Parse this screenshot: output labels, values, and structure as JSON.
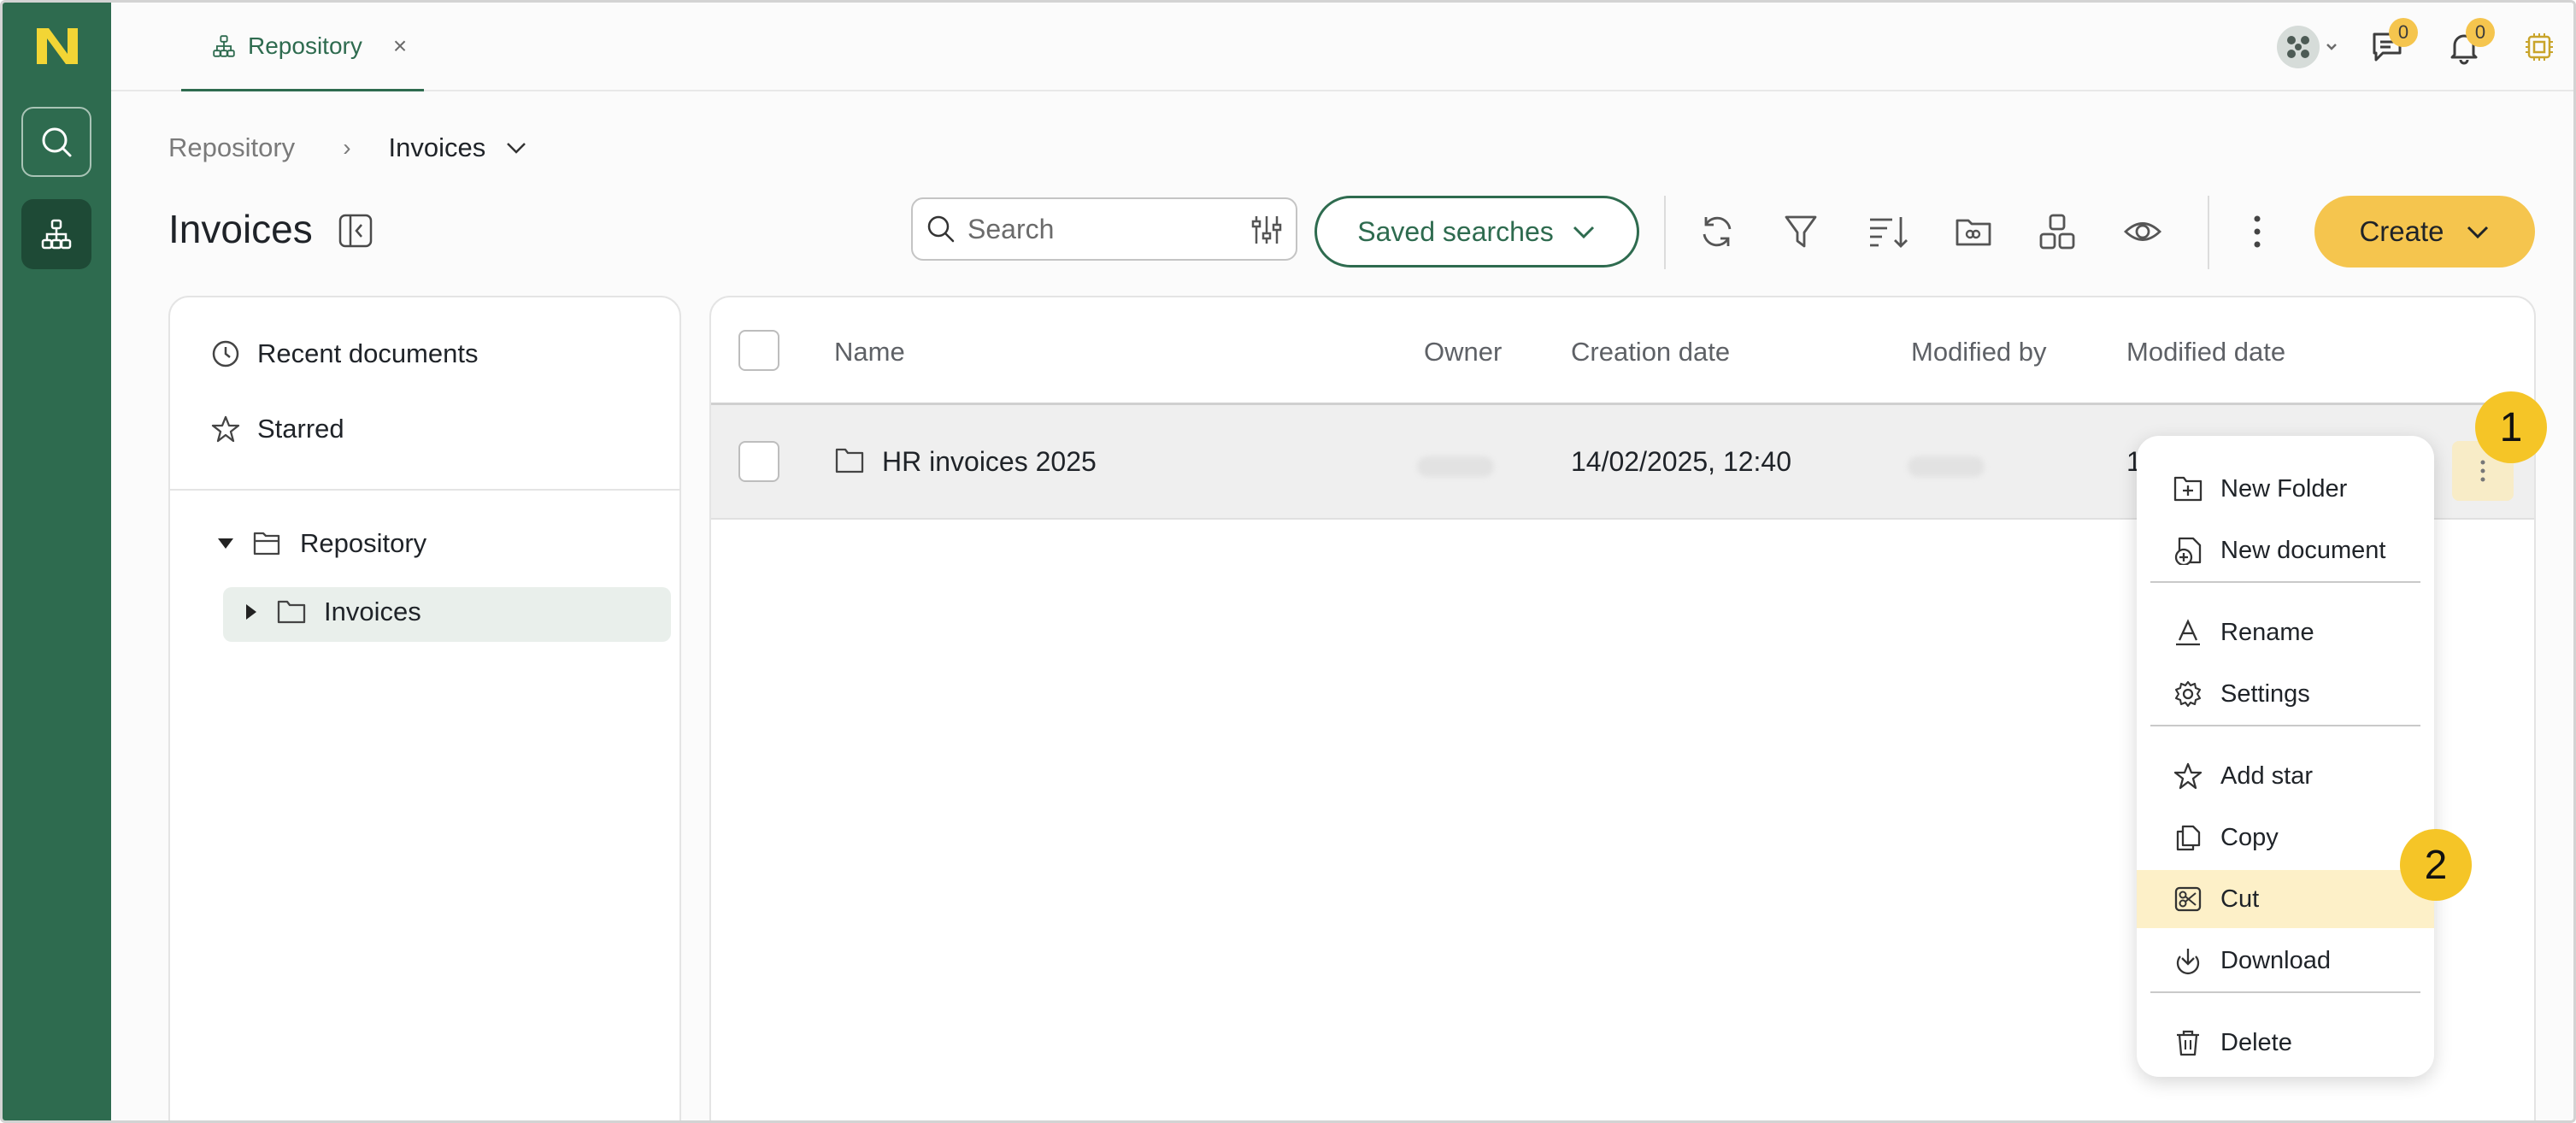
{
  "app": {
    "tab_label": "Repository",
    "tab_close": "×",
    "badges": {
      "chat": "0",
      "notifications": "0"
    }
  },
  "breadcrumb": {
    "root": "Repository",
    "separator": "›",
    "current": "Invoices"
  },
  "page": {
    "title": "Invoices"
  },
  "toolbar": {
    "search_placeholder": "Search",
    "saved_searches_label": "Saved searches",
    "create_label": "Create"
  },
  "sidebar": {
    "recent": "Recent documents",
    "starred": "Starred",
    "tree_root": "Repository",
    "tree_child": "Invoices"
  },
  "table": {
    "columns": [
      "Name",
      "Owner",
      "Creation date",
      "Modified by",
      "Modified date"
    ],
    "rows": [
      {
        "name": "HR invoices 2025",
        "creation_date": "14/02/2025, 12:40",
        "modified_date_partial": "1"
      }
    ]
  },
  "context_menu": {
    "items": [
      "New Folder",
      "New document",
      "Rename",
      "Settings",
      "Add star",
      "Copy",
      "Cut",
      "Download",
      "Delete"
    ],
    "highlighted": "Cut"
  },
  "steps": {
    "first": "1",
    "second": "2"
  },
  "colors": {
    "brand_green": "#2e6b4f",
    "accent_yellow": "#f5c54e",
    "highlight": "#fdf0c8"
  }
}
